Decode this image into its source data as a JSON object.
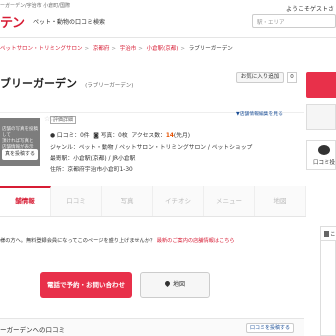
{
  "header": {
    "top_crumb": "ーガーデン/宇治市 小倉町/国際",
    "logo": "テン",
    "tagline": "ペット・動物の口コミ検索",
    "welcome": "ようこそゲストさ",
    "search_placeholder": "駅・エリア"
  },
  "breadcrumb": [
    {
      "label": "ペットサロン・トリミングサロン",
      "link": true
    },
    {
      "label": "京都府",
      "link": true
    },
    {
      "label": "宇治市",
      "link": true
    },
    {
      "label": "小倉駅(京都)",
      "link": true
    },
    {
      "label": "ラブリーガーデン",
      "link": false
    }
  ],
  "shop": {
    "title": "ブリーガーデン",
    "kana": "(ラブリーガーデン)",
    "fav_label": "お気に入り追加",
    "fav_count": "0",
    "review_link": "▼店舗情報編集を見る",
    "badge": "評価詳細",
    "reviews_label": "口コミ：0件",
    "photos_label": "写真：0枚",
    "access_label": "アクセス数：",
    "access_count": "14",
    "access_suffix": "(先月)",
    "genre": "ジャンル：ペット・動物 / ペットサロン・トリミングサロン / ペットショップ",
    "station": "最寄駅：小倉駅(京都) / JR小倉駅",
    "address": "住所：京都府宇治市小倉町1-30"
  },
  "photo_placeholder": {
    "text": "店舗の写真を投稿して\n頂ければ写真と\n店舗情報が表示\nされます",
    "button": "真を投稿する"
  },
  "right_column": {
    "review_label": "口コミ投"
  },
  "tabs": [
    "舗情報",
    "口コミ",
    "写真",
    "イチオシ",
    "メニュー",
    "地図"
  ],
  "notice": {
    "text": "様の方へ。無料登録会員になってこのページを盛り上げませんか？",
    "link": "最新のご案内の店舗情報はこちら"
  },
  "right_box_label": "この",
  "actions": {
    "call": "電話で予約・お問い合わせ",
    "map": "地図"
  },
  "reviews": {
    "heading": "ーガーデンへの口コミ",
    "more": "口コミを投稿する"
  },
  "colors": {
    "brand": "#d71c34",
    "cta": "#e8304a",
    "link": "#1a4e96"
  }
}
